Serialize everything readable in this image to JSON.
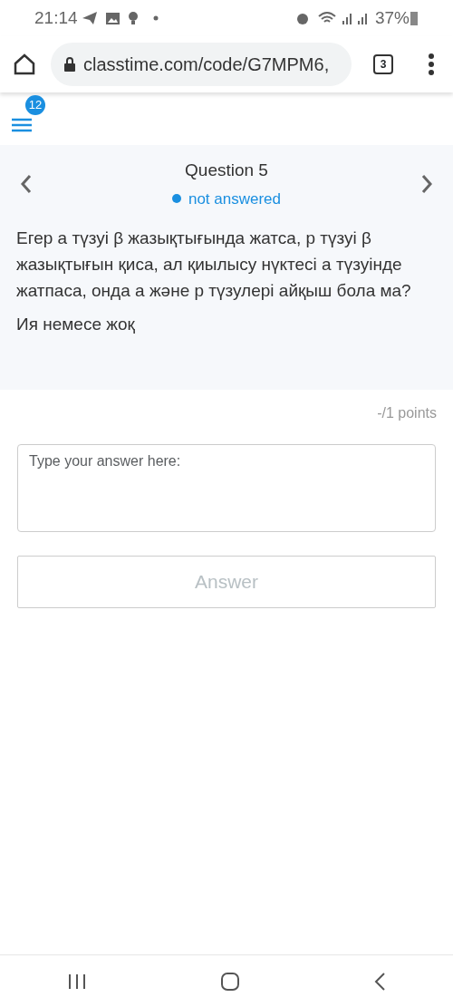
{
  "status_bar": {
    "time": "21:14",
    "battery": "37%"
  },
  "browser": {
    "url": "classtime.com/code/G7MPM6,",
    "tab_count": "3"
  },
  "menu": {
    "badge": "12"
  },
  "question": {
    "title": "Question 5",
    "status": {
      "text": "not answered",
      "color": "#1a8fe0"
    },
    "text": "Егер а түзуі β жазықтығында жатса, р түзуі β жазықтығын қиса, ал қиылысу нүктесі а түзуінде жатпаса, онда а және р түзулері айқыш бола ма?",
    "hint": "Ия немесе жоқ"
  },
  "points": "-/1 points",
  "answer": {
    "placeholder": "Type your answer here:",
    "button": "Answer",
    "disabled": true
  }
}
